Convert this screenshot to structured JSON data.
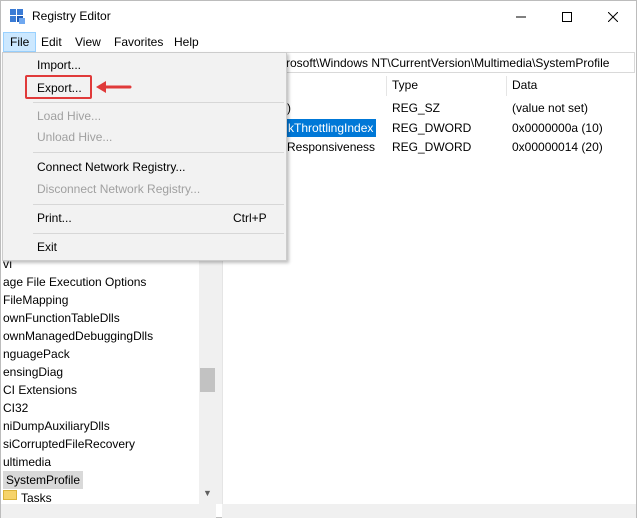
{
  "window": {
    "title": "Registry Editor",
    "minimize_symbol": "—",
    "maximize_symbol": "☐",
    "close_symbol": "✕"
  },
  "menubar": {
    "items": [
      {
        "label": "File"
      },
      {
        "label": "Edit"
      },
      {
        "label": "View"
      },
      {
        "label": "Favorites"
      },
      {
        "label": "Help"
      }
    ]
  },
  "address": {
    "text": "rosoft\\Windows NT\\CurrentVersion\\Multimedia\\SystemProfile"
  },
  "file_menu": {
    "import": "Import...",
    "export": "Export...",
    "load_hive": "Load Hive...",
    "unload_hive": "Unload Hive...",
    "connect": "Connect Network Registry...",
    "disconnect": "Disconnect Network Registry...",
    "print": "Print...",
    "print_shortcut": "Ctrl+P",
    "exit": "Exit"
  },
  "tree": {
    "items": [
      {
        "label": "vı"
      },
      {
        "label": "age File Execution Options"
      },
      {
        "label": "FileMapping"
      },
      {
        "label": "ownFunctionTableDlls"
      },
      {
        "label": "ownManagedDebuggingDlls"
      },
      {
        "label": "nguagePack"
      },
      {
        "label": "ensingDiag"
      },
      {
        "label": "CI Extensions"
      },
      {
        "label": "CI32"
      },
      {
        "label": "niDumpAuxiliaryDlls"
      },
      {
        "label": "siCorruptedFileRecovery"
      },
      {
        "label": "ultimedia"
      },
      {
        "label": "SystemProfile"
      },
      {
        "label": "Tasks"
      }
    ]
  },
  "list": {
    "headers": {
      "type": "Type",
      "data": "Data"
    },
    "rows": [
      {
        "name": ")",
        "type": "REG_SZ",
        "data": "(value not set)"
      },
      {
        "name": "kThrottlingIndex",
        "type": "REG_DWORD",
        "data": "0x0000000a (10)"
      },
      {
        "name": "Responsiveness",
        "type": "REG_DWORD",
        "data": "0x00000014 (20)"
      }
    ]
  },
  "colors": {
    "selection": "#0078d7",
    "highlight_border": "#e03a3a",
    "menu_active": "#cce8ff"
  }
}
